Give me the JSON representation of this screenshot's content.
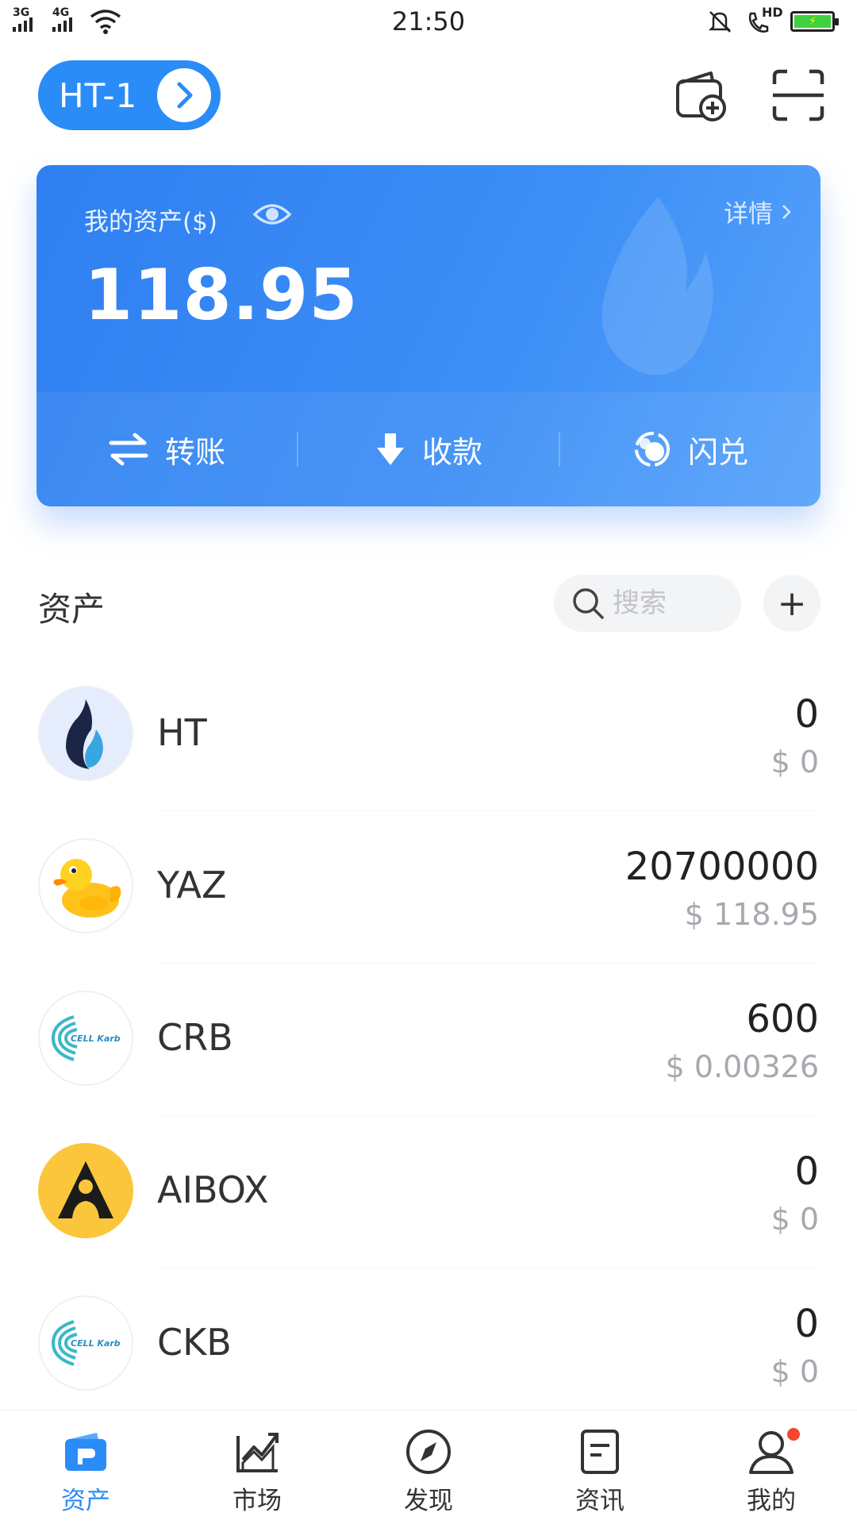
{
  "status_bar": {
    "time": "21:50",
    "signal_1_label": "3G",
    "signal_2_label": "4G",
    "hd_label": "HD",
    "icons": [
      "signal-icon",
      "wifi-icon",
      "mute-bell-icon",
      "hd-call-icon",
      "battery-charging-icon"
    ]
  },
  "header": {
    "wallet_name": "HT-1",
    "icons": [
      "chevron-right-icon",
      "add-wallet-icon",
      "scan-icon"
    ]
  },
  "asset_card": {
    "label": "我的资产($)",
    "detail_label": "详情",
    "balance": "118.95",
    "actions": [
      {
        "label": "转账",
        "icon": "transfer-icon"
      },
      {
        "label": "收款",
        "icon": "receive-icon"
      },
      {
        "label": "闪兑",
        "icon": "swap-icon"
      }
    ]
  },
  "assets_section": {
    "title": "资产",
    "search_placeholder": "搜索",
    "add_label": "+"
  },
  "tokens": [
    {
      "symbol": "HT",
      "amount": "0",
      "usd": "$ 0",
      "logo": "ht-flame-logo"
    },
    {
      "symbol": "YAZ",
      "amount": "20700000",
      "usd": "$ 118.95",
      "logo": "rubber-duck-logo"
    },
    {
      "symbol": "CRB",
      "amount": "600",
      "usd": "$ 0.00326",
      "logo": "cell-karb-logo",
      "logo_text": "CELL Karb"
    },
    {
      "symbol": "AIBOX",
      "amount": "0",
      "usd": "$ 0",
      "logo": "aibox-logo"
    },
    {
      "symbol": "CKB",
      "amount": "0",
      "usd": "$ 0",
      "logo": "cell-karb-logo",
      "logo_text": "CELL Karb"
    }
  ],
  "bottom_nav": [
    {
      "label": "资产",
      "icon": "wallet-icon",
      "active": true
    },
    {
      "label": "市场",
      "icon": "market-chart-icon",
      "active": false
    },
    {
      "label": "发现",
      "icon": "compass-icon",
      "active": false
    },
    {
      "label": "资讯",
      "icon": "news-icon",
      "active": false
    },
    {
      "label": "我的",
      "icon": "profile-icon",
      "active": false
    }
  ],
  "colors": {
    "primary": "#2A8CF7",
    "card_gradient_start": "#2F7FF1",
    "card_gradient_end": "#58A3FB",
    "notification_dot": "#F4472B",
    "muted_text": "#A6A9AE"
  }
}
